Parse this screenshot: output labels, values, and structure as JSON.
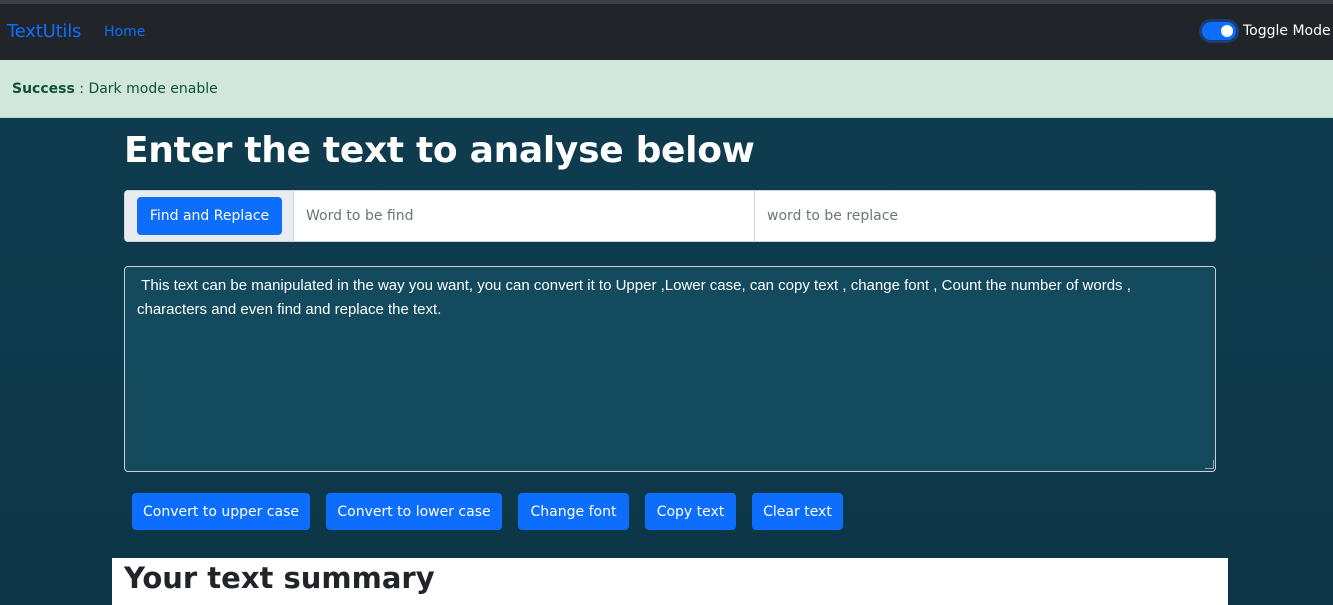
{
  "navbar": {
    "brand": "TextUtils",
    "home_link": "Home",
    "toggle_label": "Toggle Mode",
    "toggle_on": true
  },
  "alert": {
    "type_label": "Success",
    "separator": " : ",
    "message": "Dark mode enable"
  },
  "main": {
    "heading": "Enter the text to analyse below",
    "find_replace": {
      "button_label": "Find and Replace",
      "find_placeholder": "Word to be find",
      "replace_placeholder": "word to be replace"
    },
    "textarea_value": " This text can be manipulated in the way you want, you can convert it to Upper ,Lower case, can copy text , change font , Count the number of words , characters and even find and replace the text.",
    "actions": {
      "upper": "Convert to upper case",
      "lower": "Convert to lower case",
      "font": "Change font",
      "copy": "Copy text",
      "clear": "Clear text"
    },
    "summary_heading": "Your text summary"
  },
  "colors": {
    "primary": "#0d6efd",
    "navbar_bg": "#212529",
    "alert_bg": "#d1e7dd",
    "page_bg": "#0e3a4c",
    "textarea_bg": "#134a5e"
  }
}
